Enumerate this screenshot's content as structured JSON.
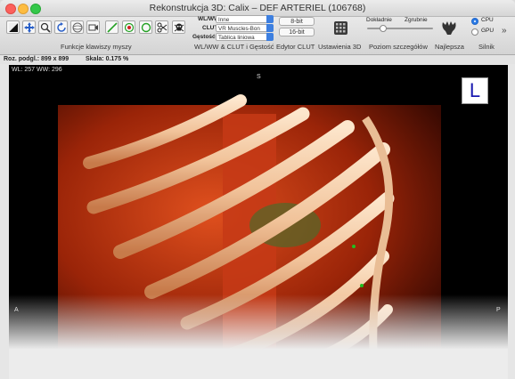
{
  "window": {
    "title": "Rekonstrukcja 3D: Calix – DEF ARTERIEL (106768)"
  },
  "toolbar": {
    "mouse_tools": [
      {
        "icon": "wl-ww-icon"
      },
      {
        "icon": "move-icon"
      },
      {
        "icon": "zoom-icon"
      },
      {
        "icon": "rotate-icon"
      },
      {
        "icon": "3d-rotate-icon"
      },
      {
        "icon": "camera-icon"
      },
      {
        "icon": "length-icon"
      },
      {
        "icon": "point-icon"
      },
      {
        "icon": "oval-icon"
      },
      {
        "icon": "scissors-icon"
      },
      {
        "icon": "skull-icon"
      }
    ],
    "mouse_functions_label": "Funkcje klawiszy myszy",
    "wlww_label": "WL/WW:",
    "wlww_value": "Inne",
    "clut_label": "CLUT:",
    "clut_value": "VR Muscles-Bon",
    "opacity_label": "Gęstość:",
    "opacity_value": "Tablica liniowa",
    "wlww_section_label": "WL/WW & CLUT i Gęstość",
    "bit8_label": "8-bit",
    "bit16_label": "16-bit",
    "clut_editor_label": "Edytor CLUT",
    "settings3d_label": "Ustawienia 3D",
    "detail_fine": "Dokładnie",
    "detail_coarse": "Zgrubnie",
    "detail_level_label": "Poziom szczegółów",
    "best_label": "Najlepsza",
    "cpu_label": "CPU",
    "gpu_label": "GPU",
    "engine_label": "Silnik",
    "engine_selected": "CPU",
    "overflow_label": "»"
  },
  "info": {
    "preview_size": "Roz. podgl.: 899 x 899",
    "scale": "Skala: 0.175 %"
  },
  "viewer": {
    "wl_ww": "WL: 257 WW: 296",
    "orientation_top": "S",
    "orientation_left": "A",
    "orientation_right": "P",
    "orientation_cube": "L"
  },
  "colors": {
    "accent": "#2b7be6",
    "bone": "#f3d0b0",
    "flesh": "#d9491c"
  }
}
